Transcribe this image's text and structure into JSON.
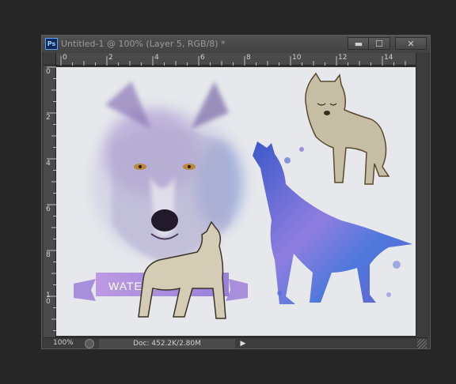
{
  "app": {
    "logo_text": "Ps"
  },
  "window": {
    "title": "Untitled-1 @ 100% (Layer 5, RGB/8) *",
    "minimize_label": "▬",
    "maximize_label": "☐",
    "close_label": "✕"
  },
  "ruler": {
    "top_labels": [
      "0",
      "2",
      "4",
      "6",
      "8",
      "10",
      "12",
      "14"
    ],
    "left_labels": [
      "0",
      "2",
      "4",
      "6",
      "8",
      "1",
      "0"
    ]
  },
  "canvas": {
    "banner_text": "WATERCOL",
    "colors": {
      "paper": "#e6e8ec",
      "purple": "#9a7ad6",
      "blue": "#4f6fd8",
      "beige": "#c9bfa6"
    }
  },
  "status": {
    "zoom": "100%",
    "doc_info": "Doc: 452.2K/2.80M",
    "arrow": "▶"
  }
}
